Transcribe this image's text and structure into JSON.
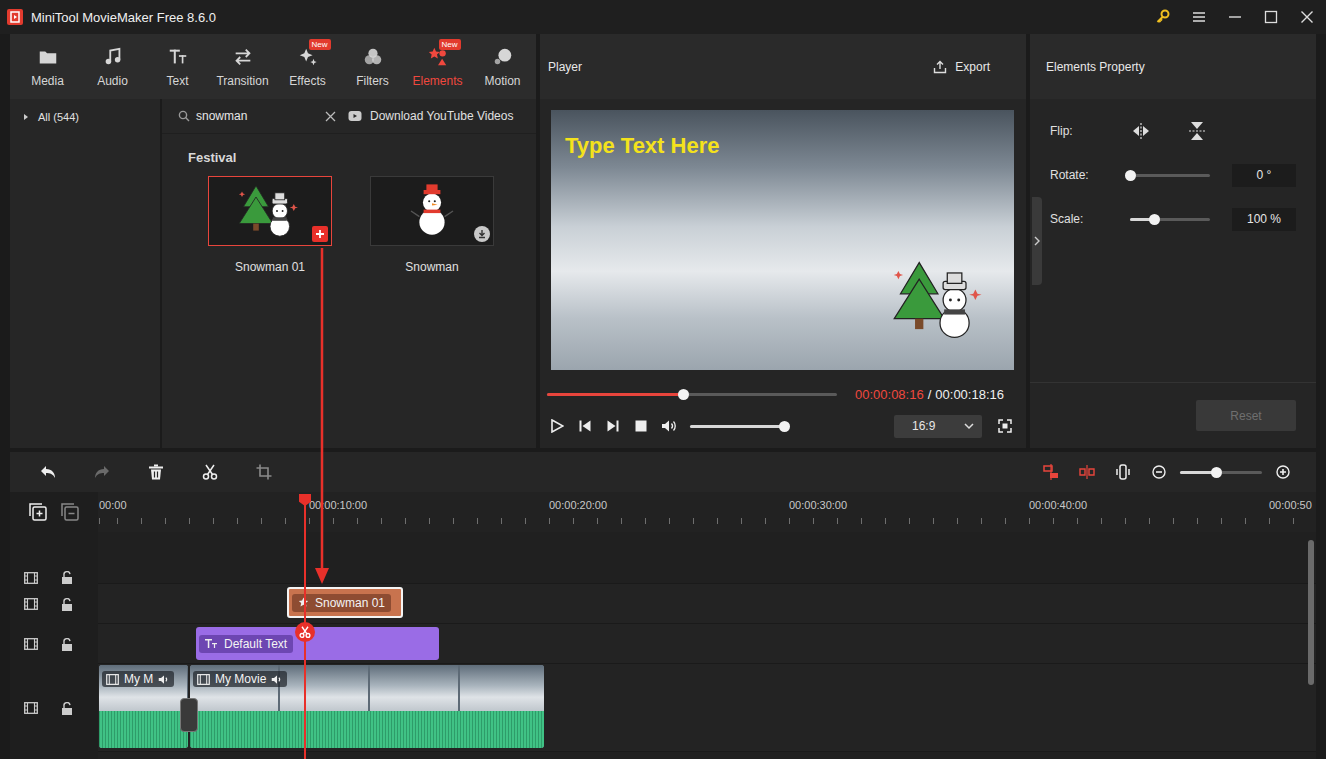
{
  "window": {
    "title": "MiniTool MovieMaker Free 8.6.0"
  },
  "toolbar_tabs": [
    {
      "label": "Media",
      "selected": false,
      "badge": ""
    },
    {
      "label": "Audio",
      "selected": false,
      "badge": ""
    },
    {
      "label": "Text",
      "selected": false,
      "badge": ""
    },
    {
      "label": "Transition",
      "selected": false,
      "badge": ""
    },
    {
      "label": "Effects",
      "selected": false,
      "badge": "New"
    },
    {
      "label": "Filters",
      "selected": false,
      "badge": ""
    },
    {
      "label": "Elements",
      "selected": true,
      "badge": "New"
    },
    {
      "label": "Motion",
      "selected": false,
      "badge": ""
    }
  ],
  "library": {
    "sidebar": [
      {
        "label": "All (544)",
        "expanded": false,
        "selected": false
      }
    ],
    "search": {
      "value": "snowman"
    },
    "download_link": "Download YouTube Videos",
    "section": "Festival",
    "items": [
      {
        "name": "Snowman 01",
        "selected": true,
        "kind": "add"
      },
      {
        "name": "Snowman",
        "selected": false,
        "kind": "download"
      }
    ]
  },
  "player": {
    "title": "Player",
    "export": "Export",
    "overlay_text": "Type Text Here",
    "progress": {
      "level": 0.47
    },
    "current_time": "00:00:08:16",
    "separator": "/",
    "total_time": "00:00:18:16",
    "playing": false,
    "volume": {
      "level": 0.94
    },
    "aspect_ratio": "16:9"
  },
  "property": {
    "title": "Elements Property",
    "rows": [
      {
        "label": "Flip:",
        "kind": "flip"
      },
      {
        "label": "Rotate:",
        "kind": "slider",
        "level": 0,
        "reading": "0 °"
      },
      {
        "label": "Scale:",
        "kind": "slider",
        "level": 0.3,
        "reading": "100 %"
      }
    ],
    "reset": {
      "label": "Reset",
      "disabled": true
    }
  },
  "timeline_toolbar": {
    "redo_disabled": true,
    "zoom": {
      "level": 0.44
    }
  },
  "timeline": {
    "ruler": [
      "00:00",
      "00:00:10:00",
      "00:00:20:00",
      "00:00:30:00",
      "00:00:40:00",
      "00:00:50"
    ],
    "tracks": [
      {
        "kind": "empty",
        "locked": false,
        "clips": []
      },
      {
        "kind": "element",
        "locked": false,
        "clips": [
          {
            "label": "Snowman 01",
            "selected": true
          }
        ]
      },
      {
        "kind": "text",
        "locked": false,
        "clips": [
          {
            "label": "Default Text",
            "selected": false
          }
        ]
      },
      {
        "kind": "video",
        "locked": false,
        "clips": [
          {
            "label": "My M",
            "selected": false
          },
          {
            "label": "My Movie",
            "selected": false
          }
        ]
      }
    ]
  }
}
